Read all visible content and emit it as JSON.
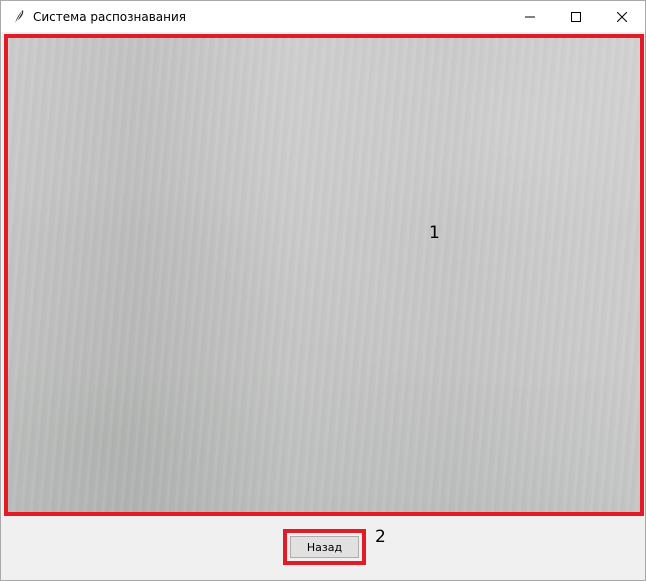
{
  "window": {
    "title": "Система распознавания",
    "icon": "feather-icon",
    "controls": {
      "minimize": "minimize-icon",
      "maximize": "maximize-icon",
      "close": "close-icon"
    }
  },
  "main": {
    "camera_view_icon": "camera-feed",
    "annotation_1": "1",
    "back_button_label": "Назад",
    "annotation_2": "2",
    "highlight_color": "#e31b25"
  }
}
